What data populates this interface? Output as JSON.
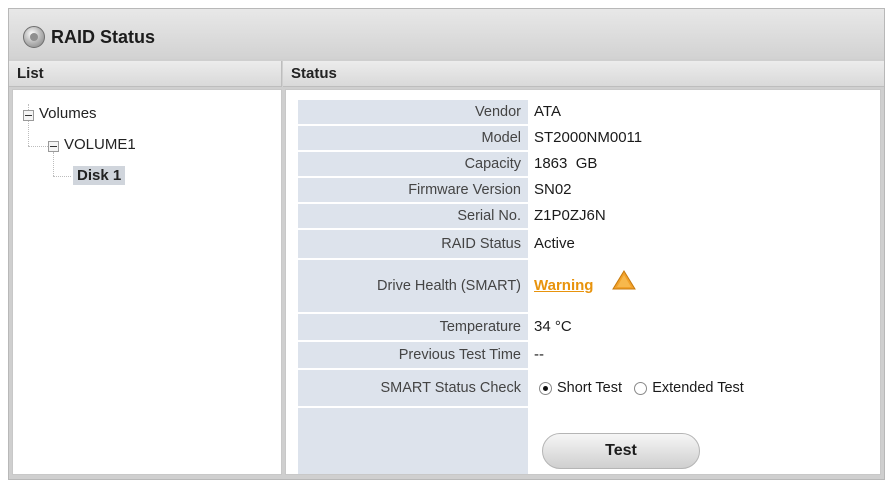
{
  "window": {
    "title": "RAID Status",
    "title_icon": "disk-icon"
  },
  "headers": {
    "list": "List",
    "status": "Status"
  },
  "tree": {
    "root": "Volumes",
    "volume": "VOLUME1",
    "disk": "Disk 1"
  },
  "status": {
    "rows": [
      {
        "label": "Vendor",
        "value": "ATA"
      },
      {
        "label": "Model",
        "value": "ST2000NM0011"
      },
      {
        "label": "Capacity",
        "value": "1863  GB"
      },
      {
        "label": "Firmware Version",
        "value": "SN02"
      },
      {
        "label": "Serial No.",
        "value": "Z1P0ZJ6N"
      },
      {
        "label": "RAID Status",
        "value": "Active"
      },
      {
        "label": "Drive Health (SMART)",
        "value": "Warning"
      },
      {
        "label": "Temperature",
        "value": "34 °C"
      },
      {
        "label": "Previous Test Time",
        "value": "--"
      },
      {
        "label": "SMART Status Check",
        "value": ""
      }
    ],
    "smart_options": {
      "short": "Short Test",
      "extended": "Extended Test",
      "selected": "short"
    },
    "test_button": "Test"
  },
  "colors": {
    "warning": "#e8930c",
    "label_bg": "#dde3ec"
  }
}
